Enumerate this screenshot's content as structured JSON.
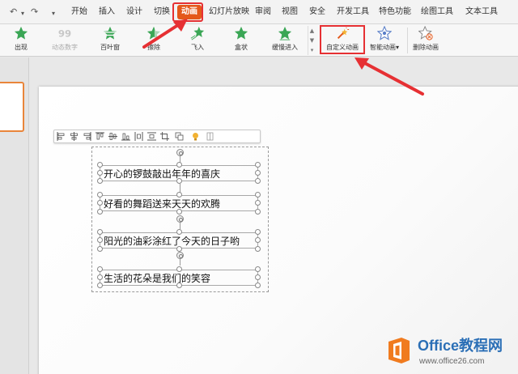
{
  "menu": {
    "undo_glyph": "↶",
    "redo_glyph": "↷",
    "dropdown_glyph": "▾",
    "tabs": [
      {
        "label": "开始"
      },
      {
        "label": "插入"
      },
      {
        "label": "设计"
      },
      {
        "label": "切换"
      },
      {
        "label": "动画",
        "active": true
      },
      {
        "label": "幻灯片放映"
      },
      {
        "label": "审阅"
      },
      {
        "label": "视图"
      },
      {
        "label": "安全"
      },
      {
        "label": "开发工具"
      },
      {
        "label": "特色功能"
      },
      {
        "label": "绘图工具"
      },
      {
        "label": "文本工具"
      }
    ]
  },
  "ribbon": {
    "effects": [
      {
        "label": "出现",
        "icon": "star-icon"
      },
      {
        "label": "动态数字",
        "icon": "number-99-icon",
        "disabled": true
      },
      {
        "label": "百叶窗",
        "icon": "star-blinds-icon"
      },
      {
        "label": "擦除",
        "icon": "star-wipe-icon"
      },
      {
        "label": "飞入",
        "icon": "star-fly-icon"
      },
      {
        "label": "盒状",
        "icon": "star-box-icon"
      },
      {
        "label": "缓慢进入",
        "icon": "star-slow-icon"
      }
    ],
    "gallery_arrows": [
      "▲",
      "▼",
      "▾"
    ],
    "custom_animation": {
      "label": "自定义动画",
      "icon": "custom-animation-icon"
    },
    "smart_animation": {
      "label": "智能动画",
      "dropdown": "▾",
      "icon": "smart-animation-icon"
    },
    "delete_animation": {
      "label": "删除动画",
      "icon": "delete-animation-icon"
    }
  },
  "slide": {
    "lines": [
      "开心的锣鼓敲出年年的喜庆",
      "好看的舞蹈送来天天的欢腾",
      "阳光的油彩涂红了今天的日子哟",
      "生活的花朵是我们的笑容"
    ]
  },
  "watermark": {
    "name": "Office教程网",
    "url": "www.office26.com"
  },
  "colors": {
    "accent": "#e4581a",
    "highlight": "#e63033",
    "effect_green": "#3aa655",
    "watermark_blue": "#2b6fb6",
    "watermark_orange": "#f07b1f"
  }
}
